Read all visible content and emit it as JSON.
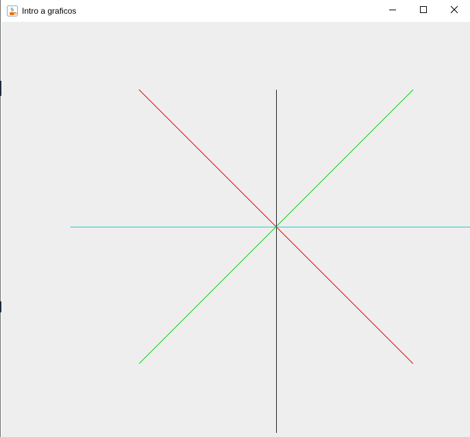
{
  "window": {
    "title": "Intro a graficos",
    "app_icon": "java-cup-icon"
  },
  "controls": {
    "minimize_icon": "minimize-icon",
    "maximize_icon": "maximize-icon",
    "close_icon": "close-icon"
  },
  "lines": [
    {
      "name": "red-diagonal-line",
      "color": "#e01010"
    },
    {
      "name": "green-diagonal-line",
      "color": "#18d018"
    },
    {
      "name": "vertical-line",
      "color": "#202020"
    },
    {
      "name": "horizontal-line",
      "color": "#20c8c8"
    }
  ]
}
